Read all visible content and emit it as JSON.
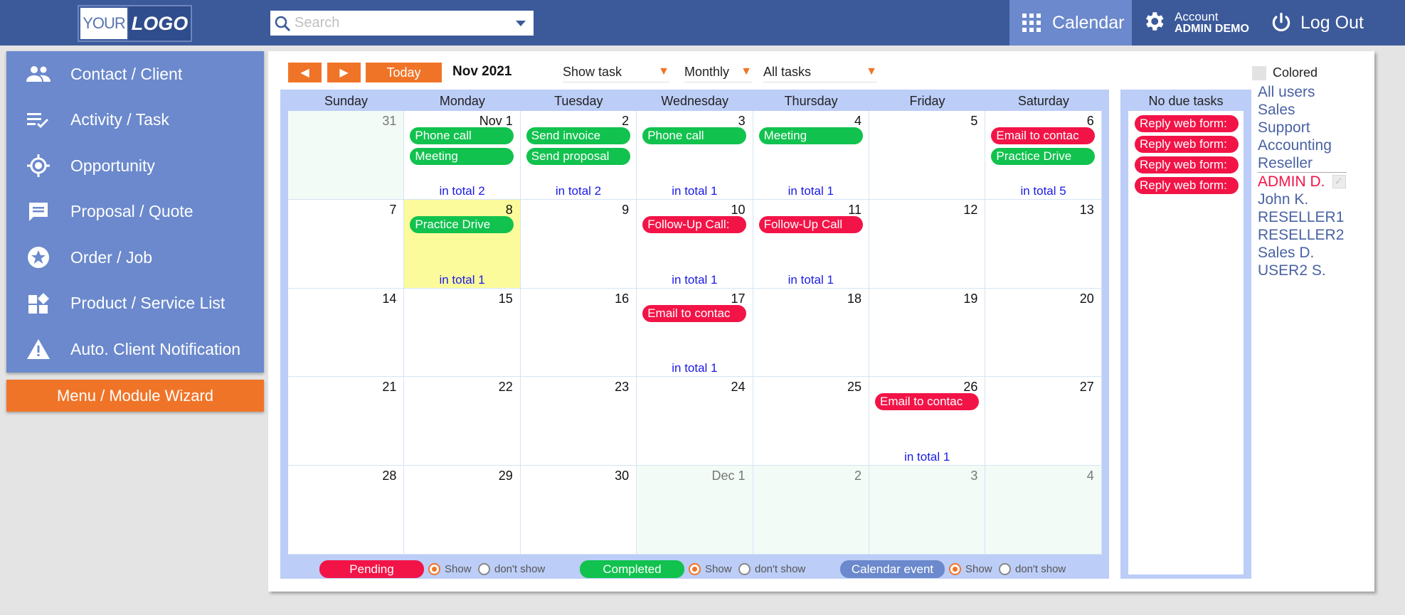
{
  "header": {
    "logo_left": "YOUR",
    "logo_right": "LOGO",
    "search_placeholder": "Search",
    "calendar_label": "Calendar",
    "account_label": "Account",
    "account_user": "ADMIN DEMO",
    "logout_label": "Log Out",
    "icons": [
      "search-icon",
      "chevron-down-icon",
      "grid-icon",
      "gear-icon",
      "power-icon"
    ]
  },
  "sidebar": {
    "items": [
      {
        "label": "Contact / Client",
        "icon": "people-icon"
      },
      {
        "label": "Activity / Task",
        "icon": "checklist-icon"
      },
      {
        "label": "Opportunity",
        "icon": "target-icon"
      },
      {
        "label": "Proposal / Quote",
        "icon": "chat-icon"
      },
      {
        "label": "Order / Job",
        "icon": "star-circle-icon"
      },
      {
        "label": "Product / Service List",
        "icon": "widgets-icon"
      },
      {
        "label": "Auto. Client Notification",
        "icon": "warning-icon"
      }
    ],
    "wizard_label": "Menu / Module Wizard"
  },
  "toolbar": {
    "prev": "◀",
    "next": "▶",
    "today": "Today",
    "month": "Nov 2021",
    "show_task": "Show task",
    "view": "Monthly",
    "filter": "All tasks",
    "caret": "▼"
  },
  "calendar": {
    "day_names": [
      "Sunday",
      "Monday",
      "Tuesday",
      "Wednesday",
      "Thursday",
      "Friday",
      "Saturday"
    ],
    "weeks": [
      [
        {
          "date": "31",
          "other": true,
          "events": []
        },
        {
          "date": "Nov 1",
          "events": [
            {
              "t": "Phone call",
              "c": "green"
            },
            {
              "t": "Meeting",
              "c": "green"
            }
          ],
          "total": "in total 2"
        },
        {
          "date": "2",
          "events": [
            {
              "t": "Send invoice",
              "c": "green"
            },
            {
              "t": "Send proposal",
              "c": "green"
            }
          ],
          "total": "in total 2"
        },
        {
          "date": "3",
          "events": [
            {
              "t": "Phone call",
              "c": "green"
            }
          ],
          "total": "in total 1"
        },
        {
          "date": "4",
          "events": [
            {
              "t": "Meeting",
              "c": "green"
            }
          ],
          "total": "in total 1"
        },
        {
          "date": "5",
          "events": []
        },
        {
          "date": "6",
          "events": [
            {
              "t": "Email to contac",
              "c": "red"
            },
            {
              "t": "Practice Drive",
              "c": "green"
            }
          ],
          "total": "in total 5"
        }
      ],
      [
        {
          "date": "7",
          "events": []
        },
        {
          "date": "8",
          "today": true,
          "events": [
            {
              "t": "Practice Drive",
              "c": "green"
            }
          ],
          "total": "in total 1"
        },
        {
          "date": "9",
          "events": []
        },
        {
          "date": "10",
          "events": [
            {
              "t": "Follow-Up Call:",
              "c": "red"
            }
          ],
          "total": "in total 1"
        },
        {
          "date": "11",
          "events": [
            {
              "t": "Follow-Up Call",
              "c": "red"
            }
          ],
          "total": "in total 1"
        },
        {
          "date": "12",
          "events": []
        },
        {
          "date": "13",
          "events": []
        }
      ],
      [
        {
          "date": "14",
          "events": []
        },
        {
          "date": "15",
          "events": []
        },
        {
          "date": "16",
          "events": []
        },
        {
          "date": "17",
          "events": [
            {
              "t": "Email to contac",
              "c": "red"
            }
          ],
          "total": "in total 1"
        },
        {
          "date": "18",
          "events": []
        },
        {
          "date": "19",
          "events": []
        },
        {
          "date": "20",
          "events": []
        }
      ],
      [
        {
          "date": "21",
          "events": []
        },
        {
          "date": "22",
          "events": []
        },
        {
          "date": "23",
          "events": []
        },
        {
          "date": "24",
          "events": []
        },
        {
          "date": "25",
          "events": []
        },
        {
          "date": "26",
          "events": [
            {
              "t": "Email to contac",
              "c": "red"
            }
          ],
          "total": "in total 1"
        },
        {
          "date": "27",
          "events": []
        }
      ],
      [
        {
          "date": "28",
          "events": []
        },
        {
          "date": "29",
          "events": []
        },
        {
          "date": "30",
          "events": []
        },
        {
          "date": "Dec 1",
          "other": true,
          "events": []
        },
        {
          "date": "2",
          "other": true,
          "events": []
        },
        {
          "date": "3",
          "other": true,
          "events": []
        },
        {
          "date": "4",
          "other": true,
          "events": []
        }
      ]
    ]
  },
  "legend": {
    "pending": "Pending",
    "completed": "Completed",
    "calendar_event": "Calendar event",
    "show": "Show",
    "dont_show": "don't show"
  },
  "no_due": {
    "title": "No due tasks",
    "items": [
      "Reply web form:",
      "Reply web form:",
      "Reply web form:",
      "Reply web form:"
    ]
  },
  "users": {
    "colored": "Colored",
    "groups": [
      "All users",
      "Sales",
      "Support",
      "Accounting",
      "Reseller"
    ],
    "people": [
      "ADMIN D.",
      "John K.",
      "RESELLER1",
      "RESELLER2",
      "Sales D.",
      "USER2 S."
    ],
    "check": "✓"
  },
  "colors": {
    "header": "#3c5a9a",
    "sidebar": "#6b89cc",
    "accent": "#f07428",
    "pending": "#f21447",
    "completed": "#11c24e",
    "calendar_event": "#6b89cc",
    "today": "#fbfb9c"
  }
}
